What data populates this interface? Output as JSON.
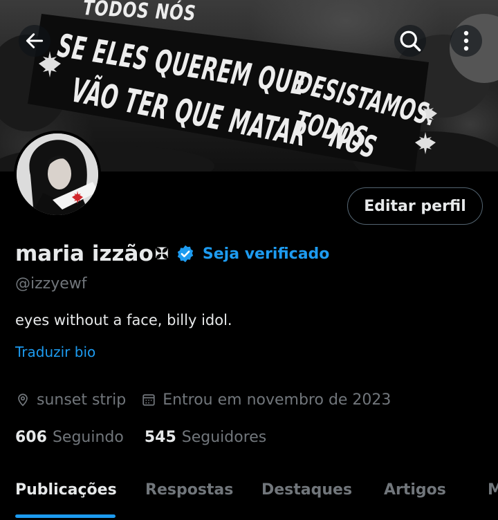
{
  "banner": {
    "lines": [
      "TODOS NÓS",
      "SE ELES QUEREM QUE",
      "VÃO TER QUE MATAR",
      "NÓS"
    ],
    "overlay_text": "DESISTAMOS. TODOS"
  },
  "header": {
    "back_icon": "arrow-left-icon",
    "search_icon": "search-icon",
    "more_icon": "more-vertical-icon"
  },
  "profile": {
    "display_name": "maria izzão",
    "name_symbol": "✠",
    "verify_link": "Seja verificado",
    "handle": "@izzyewf",
    "bio": "eyes without a face, billy idol.",
    "translate_label": "Traduzir bio",
    "location": "sunset strip",
    "joined": "Entrou em novembro de 2023",
    "following_count": "606",
    "following_label": "Seguindo",
    "followers_count": "545",
    "followers_label": "Seguidores",
    "edit_button": "Editar perfil"
  },
  "tabs": [
    "Publicações",
    "Respostas",
    "Destaques",
    "Artigos",
    "M"
  ],
  "colors": {
    "accent": "#1d9bf0",
    "text": "#e7e9ea",
    "secondary": "#71767b",
    "background": "#000000"
  }
}
